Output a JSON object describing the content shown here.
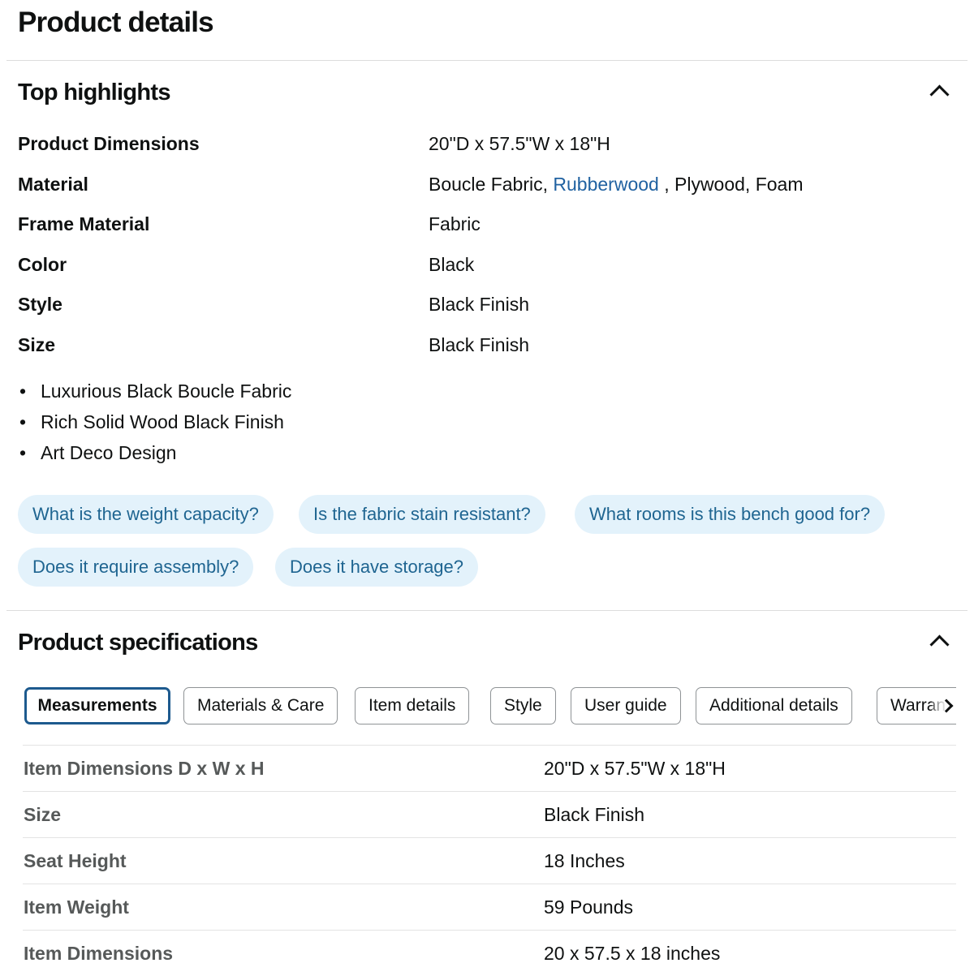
{
  "page_title": "Product details",
  "top_highlights": {
    "title": "Top highlights",
    "rows": [
      {
        "label": "Product Dimensions",
        "value": "20\"D x 57.5\"W x 18\"H"
      },
      {
        "label": "Material",
        "value_parts": [
          "Boucle Fabric, ",
          "Rubberwood",
          " , Plywood, Foam"
        ]
      },
      {
        "label": "Frame Material",
        "value": "Fabric"
      },
      {
        "label": "Color",
        "value": "Black"
      },
      {
        "label": "Style",
        "value": "Black Finish"
      },
      {
        "label": "Size",
        "value": "Black Finish"
      }
    ],
    "bullets": [
      "Luxurious Black Boucle Fabric",
      "Rich Solid Wood Black Finish",
      "Art Deco Design"
    ],
    "questions": [
      "What is the weight capacity?",
      "Is the fabric stain resistant?",
      "What rooms is this bench good for?",
      "Does it require assembly?",
      "Does it have storage?"
    ]
  },
  "product_specifications": {
    "title": "Product specifications",
    "tabs": [
      "Measurements",
      "Materials & Care",
      "Item details",
      "Style",
      "User guide",
      "Additional details",
      "Warranty"
    ],
    "active_tab": "Measurements",
    "rows": [
      {
        "label": "Item Dimensions D x W x H",
        "value": "20\"D x 57.5\"W x 18\"H"
      },
      {
        "label": "Size",
        "value": "Black Finish"
      },
      {
        "label": "Seat Height",
        "value": "18 Inches"
      },
      {
        "label": "Item Weight",
        "value": "59 Pounds"
      },
      {
        "label": "Item Dimensions",
        "value": "20 x 57.5 x 18 inches"
      }
    ]
  },
  "colors": {
    "link": "#2162a1",
    "chip_bg": "#e3f2fb",
    "chip_text": "#1f6591",
    "active_tab_border": "#1d5a8e"
  },
  "icons": {
    "section_toggle": "chevron-up-icon",
    "tab_scroll": "chevron-right-icon"
  }
}
